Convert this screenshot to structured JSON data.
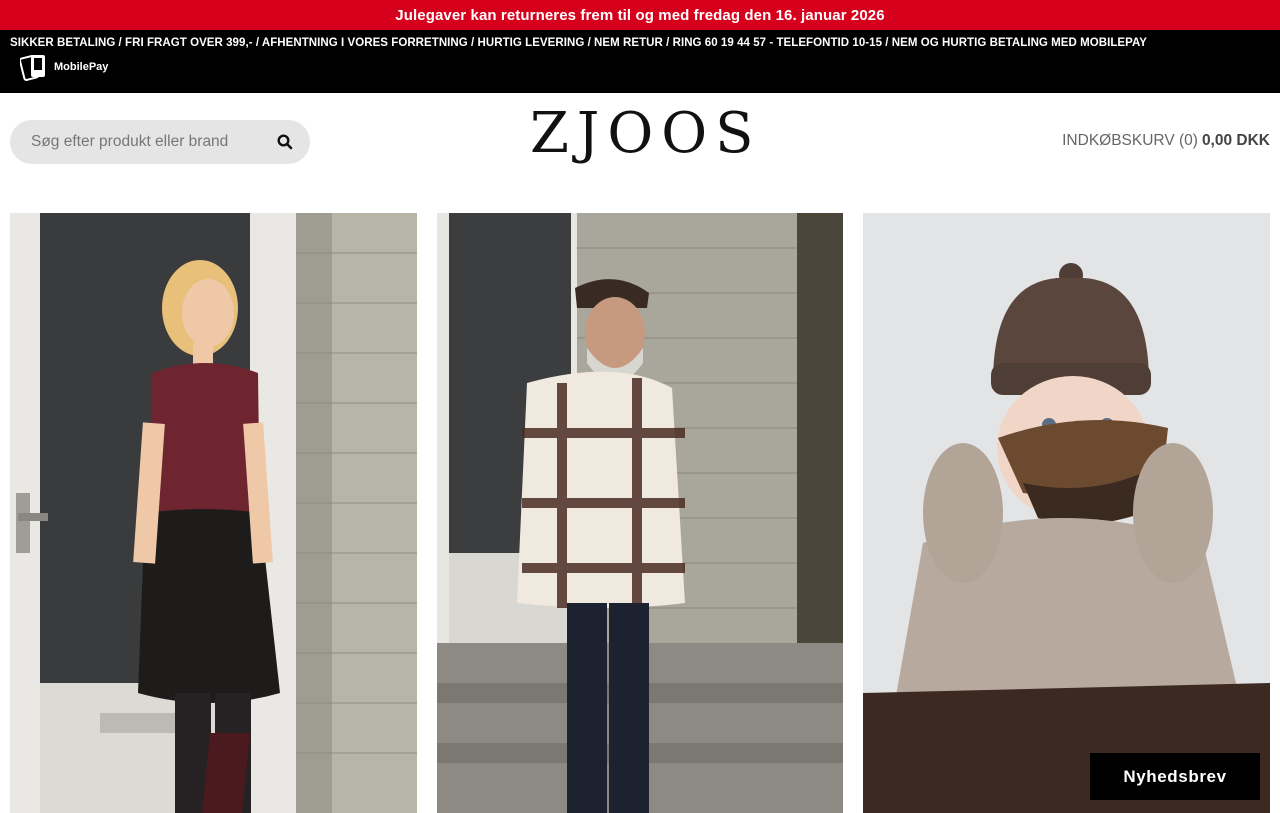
{
  "announcement": "Julegaver kan returneres frem til og med fredag den 16. januar 2026",
  "usp_line": "SIKKER BETALING  /  FRI FRAGT OVER 399,- /  AFHENTNING I VORES FORRETNING  /  HURTIG LEVERING  / NEM RETUR / RING 60 19 44 57 - TELEFONTID 10-15 / NEM OG HURTIG BETALING MED MOBILEPAY",
  "mobilepay": {
    "label": "MobilePay",
    "icon": "mobilepay-icon"
  },
  "search": {
    "placeholder": "Søg efter produkt eller brand",
    "icon": "search-icon"
  },
  "logo": "ZJOOS",
  "cart": {
    "label": "INDKØBSKURV (0)",
    "amount": "0,00 DKK"
  },
  "tiles": [
    {
      "subject": "woman-burgundy-tshirt-leather-skirt"
    },
    {
      "subject": "man-plaid-overshirt-cap"
    },
    {
      "subject": "child-knit-beanie-shoe"
    }
  ],
  "newsletter": "Nyhedsbrev",
  "colors": {
    "announcement_bg": "#d6001c",
    "infobar_bg": "#000000",
    "search_bg": "#e5e5e5",
    "newsletter_bg": "#000000"
  }
}
